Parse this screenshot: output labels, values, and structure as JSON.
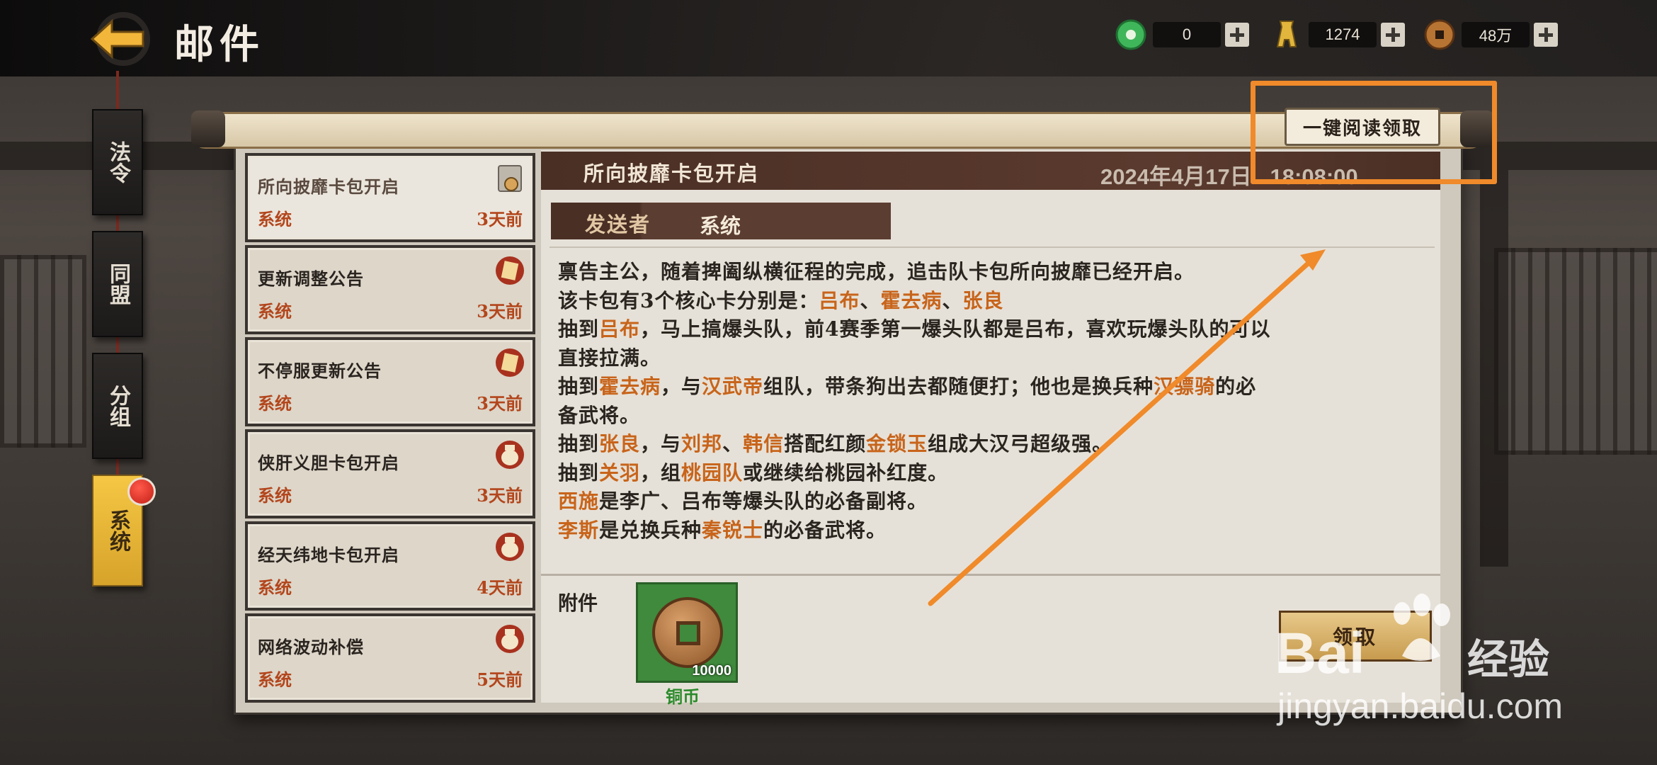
{
  "header": {
    "title": "邮件",
    "resources": [
      {
        "icon": "jade-icon",
        "value": "0"
      },
      {
        "icon": "spade-coin-icon",
        "value": "1274"
      },
      {
        "icon": "copper-coin-icon",
        "value": "48万"
      }
    ]
  },
  "side_tabs": [
    {
      "label": "法令",
      "active": false
    },
    {
      "label": "同盟",
      "active": false
    },
    {
      "label": "分组",
      "active": false
    },
    {
      "label": "系统",
      "active": true
    }
  ],
  "read_all_label": "一键阅读领取",
  "mail_list": [
    {
      "title": "所向披靡卡包开启",
      "sender": "系统",
      "time": "3天前",
      "icon": "read-scroll-icon",
      "selected": true
    },
    {
      "title": "更新调整公告",
      "sender": "系统",
      "time": "3天前",
      "icon": "notice-scroll-icon",
      "selected": false
    },
    {
      "title": "不停服更新公告",
      "sender": "系统",
      "time": "3天前",
      "icon": "notice-scroll-icon",
      "selected": false
    },
    {
      "title": "侠肝义胆卡包开启",
      "sender": "系统",
      "time": "3天前",
      "icon": "gift-bag-icon",
      "selected": false
    },
    {
      "title": "经天纬地卡包开启",
      "sender": "系统",
      "time": "4天前",
      "icon": "gift-bag-icon",
      "selected": false
    },
    {
      "title": "网络波动补偿",
      "sender": "系统",
      "time": "5天前",
      "icon": "gift-bag-icon",
      "selected": false
    }
  ],
  "detail": {
    "title": "所向披靡卡包开启",
    "date": "2024年4月17日",
    "time": "18:08:00",
    "sender_label": "发送者",
    "sender_value": "系统",
    "body_lines": [
      [
        {
          "t": "禀告主公，随着捭阖纵横征程的完成，追击队卡包所向披靡已经开启。"
        }
      ],
      [
        {
          "t": "该卡包有3个核心卡分别是："
        },
        {
          "t": "吕布",
          "hl": true
        },
        {
          "t": "、"
        },
        {
          "t": "霍去病",
          "hl": true
        },
        {
          "t": "、"
        },
        {
          "t": "张良",
          "hl": true
        }
      ],
      [
        {
          "t": "抽到"
        },
        {
          "t": "吕布",
          "hl": true
        },
        {
          "t": "，马上搞爆头队，前4赛季第一爆头队都是吕布，喜欢玩爆头队的可以"
        }
      ],
      [
        {
          "t": "直接拉满。"
        }
      ],
      [
        {
          "t": "抽到"
        },
        {
          "t": "霍去病",
          "hl": true
        },
        {
          "t": "，与"
        },
        {
          "t": "汉武帝",
          "hl": true
        },
        {
          "t": "组队，带条狗出去都随便打；他也是换兵种"
        },
        {
          "t": "汉骠骑",
          "hl": true
        },
        {
          "t": "的必"
        }
      ],
      [
        {
          "t": "备武将。"
        }
      ],
      [
        {
          "t": "抽到"
        },
        {
          "t": "张良",
          "hl": true
        },
        {
          "t": "，与"
        },
        {
          "t": "刘邦",
          "hl": true
        },
        {
          "t": "、"
        },
        {
          "t": "韩信",
          "hl": true
        },
        {
          "t": "搭配红颜"
        },
        {
          "t": "金锁玉",
          "hl": true
        },
        {
          "t": "组成大汉弓超级强。"
        }
      ],
      [
        {
          "t": "抽到"
        },
        {
          "t": "关羽",
          "hl": true
        },
        {
          "t": "，组"
        },
        {
          "t": "桃园队",
          "hl": true
        },
        {
          "t": "或继续给桃园补红度。"
        }
      ],
      [
        {
          "t": "西施",
          "hl": true
        },
        {
          "t": "是李广、吕布等爆头队的必备副将。"
        }
      ],
      [
        {
          "t": "李斯",
          "hl": true
        },
        {
          "t": "是兑换兵种"
        },
        {
          "t": "秦锐士",
          "hl": true
        },
        {
          "t": "的必备武将。"
        }
      ]
    ],
    "attachment_label": "附件",
    "attachment": {
      "name": "铜币",
      "count": "10000",
      "icon": "copper-coin-icon"
    },
    "claim_label": "领取"
  },
  "watermark": {
    "brand": "Bai",
    "brand_suffix": "经验",
    "url": "jingyan.baidu.com"
  },
  "colors": {
    "highlight": "#c8641a",
    "annotation": "#f08a2a",
    "active_tab": "#f5c744"
  }
}
